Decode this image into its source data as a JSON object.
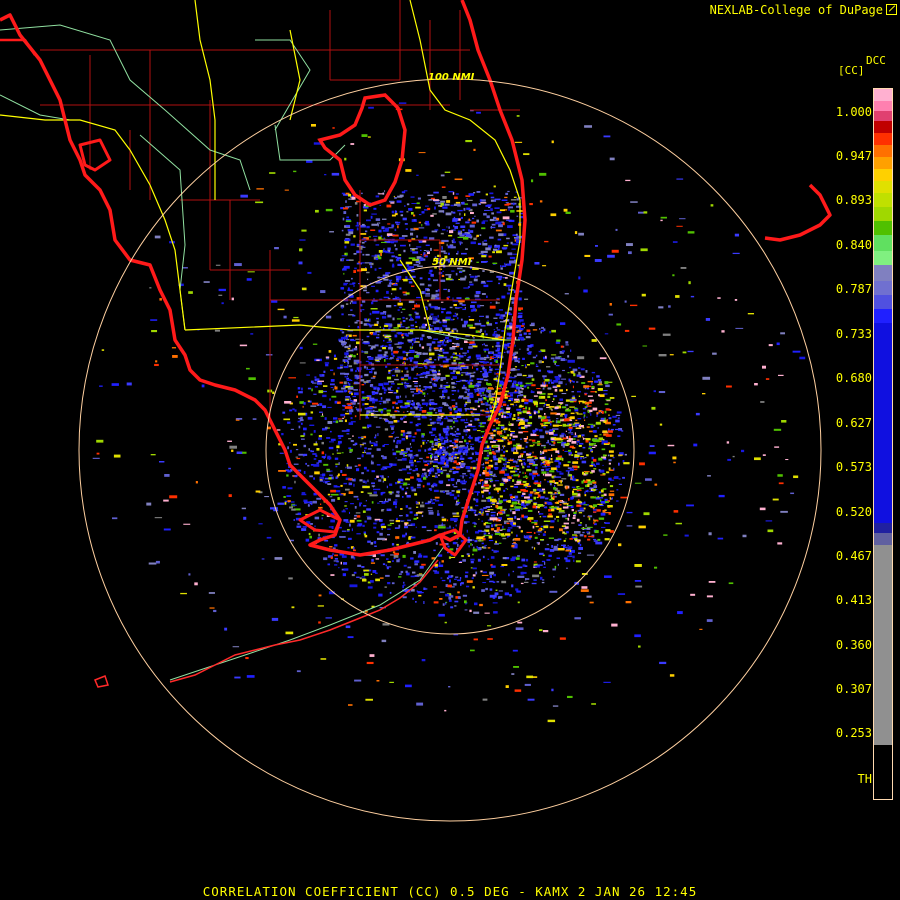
{
  "header": {
    "credit": "NEXLAB-College of DuPage"
  },
  "legend": {
    "product_code": "DCC",
    "unit": "[CC]",
    "ticks": [
      "1.000",
      "0.947",
      "0.893",
      "0.840",
      "0.787",
      "0.733",
      "0.680",
      "0.627",
      "0.573",
      "0.520",
      "0.467",
      "0.413",
      "0.360",
      "0.307",
      "0.253",
      "TH"
    ]
  },
  "range_rings": {
    "outer_label": "100 NMI",
    "inner_label": "50 NMI"
  },
  "footer": {
    "caption": "CORRELATION COEFFICIENT (CC) 0.5 DEG - KAMX 2 JAN 26 12:45"
  },
  "colors": {
    "background": "#000000",
    "coastline": "#ff1a1a",
    "county_lines": "#b01010",
    "roads": "#ffff00",
    "state_border": "#90e0a0",
    "range_ring": "#ffd0a0",
    "text": "#ffff00"
  }
}
